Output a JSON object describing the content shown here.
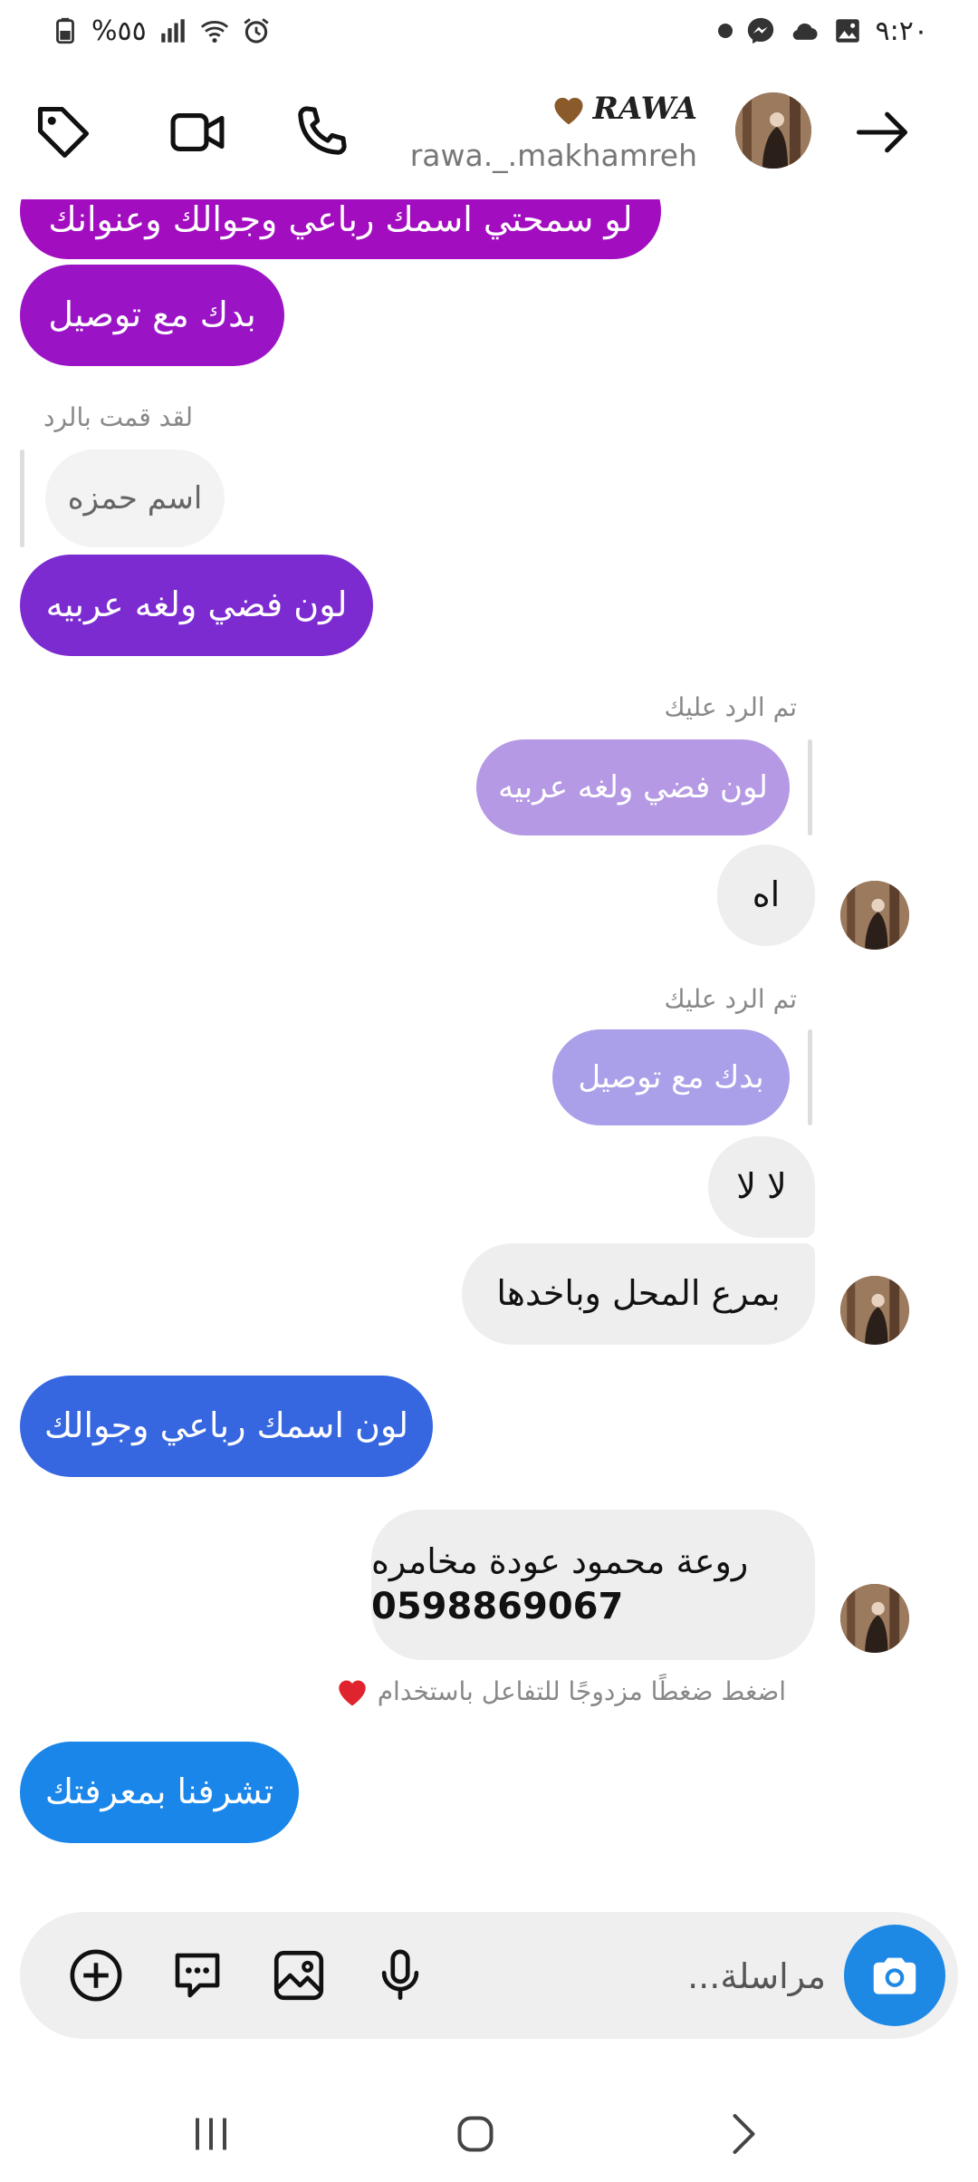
{
  "status_bar": {
    "time": "٩:٢٠",
    "battery": "%٥٥"
  },
  "header": {
    "display_name": "RAWA",
    "handle": "rawa._.makhamreh",
    "name_heart_color": "#8b5a2b"
  },
  "messages": {
    "m1": "لو سمحتي اسمك رباعي وجوالك وعنوانك",
    "m2": "بدك مع توصيل",
    "reply_note_mine": "لقد قمت بالرد",
    "quoted_mine": "اسم حمزه",
    "m3": "لون فضي ولغه عربيه",
    "reply_note_theirs_1": "تم الرد عليك",
    "quoted_theirs_1": "لون فضي ولغه عربيه",
    "t1": "اه",
    "reply_note_theirs_2": "تم الرد عليك",
    "quoted_theirs_2": "بدك مع توصيل",
    "t2": "لا لا",
    "t3": "بمرع المحل وباخدها",
    "m4": "لون اسمك رباعي وجوالك",
    "t4_line1": "روعة محمود عودة مخامره",
    "t4_line2": "0598869067",
    "reaction_hint": "اضغط ضغطًا مزدوجًا للتفاعل باستخدام",
    "m5": "تشرفنا بمعرفتك"
  },
  "colors": {
    "m1": "#a20dbf",
    "m2": "#9a14c6",
    "m3": "#7c2bd0",
    "m4": "#3666e0",
    "m5": "#1a86ea",
    "quoted_theirs_1": "#b699e4",
    "quoted_theirs_2": "#aaa0ea",
    "heart": "#e0242f"
  },
  "composer": {
    "placeholder": "مراسلة..."
  },
  "icons": [
    "back-arrow-icon",
    "tag-icon",
    "video-call-icon",
    "phone-icon",
    "camera-icon",
    "mic-icon",
    "gallery-icon",
    "sticker-icon",
    "plus-icon"
  ]
}
